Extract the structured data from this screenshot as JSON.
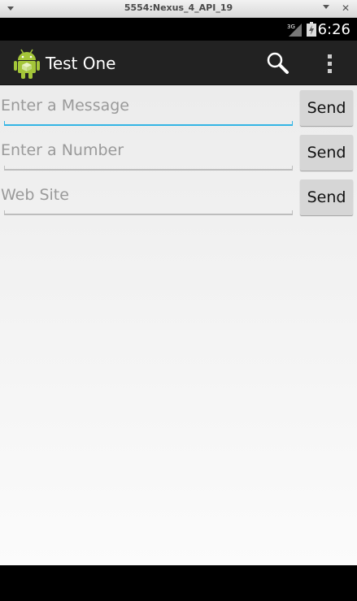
{
  "window": {
    "title": "5554:Nexus_4_API_19",
    "close_glyph": "✕"
  },
  "status_bar": {
    "network": "3G",
    "time": "6:26",
    "icons": [
      "signal-3g-icon",
      "battery-charging-icon"
    ]
  },
  "action_bar": {
    "title": "Test One",
    "icons": [
      "android-app-icon",
      "search-icon",
      "overflow-menu-icon"
    ]
  },
  "form": {
    "rows": [
      {
        "placeholder": "Enter a Message",
        "value": "",
        "button_label": "Send",
        "focused": true
      },
      {
        "placeholder": "Enter a Number",
        "value": "",
        "button_label": "Send",
        "focused": false
      },
      {
        "placeholder": "Web Site",
        "value": "",
        "button_label": "Send",
        "focused": false
      }
    ]
  },
  "colors": {
    "action_bar": "#222222",
    "focus_accent": "#33b5e5",
    "button": "#d6d6d6",
    "app_icon_green": "#a4c639"
  }
}
